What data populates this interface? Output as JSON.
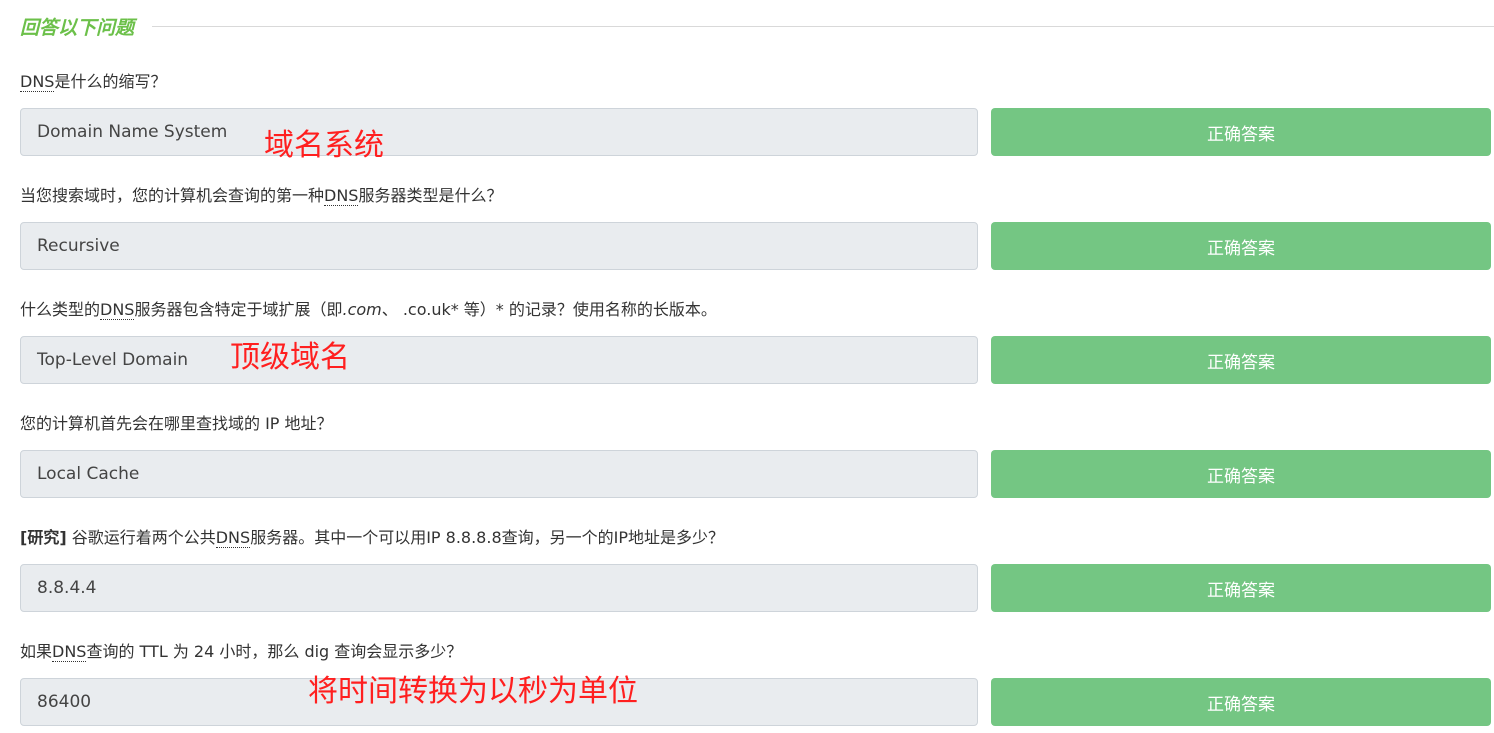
{
  "section": {
    "title": "回答以下问题"
  },
  "questions": [
    {
      "parts": [
        "",
        "DNS",
        "是什么的缩写？"
      ],
      "answer": "Domain Name System",
      "button": "正确答案",
      "note": "域名系统"
    },
    {
      "parts": [
        "当您搜索域时，您的计算机会查询的第一种",
        "DNS",
        "服务器类型是什么？"
      ],
      "answer": "Recursive",
      "button": "正确答案"
    },
    {
      "parts": [
        "什么类型的",
        "DNS",
        "服务器包含特定于域扩展（即",
        ".com",
        "、 .co.uk* 等）* 的记录？使用名称的长版本。"
      ],
      "answer": "Top-Level Domain",
      "button": "正确答案",
      "note": "顶级域名"
    },
    {
      "parts": [
        "您的计算机首先会在哪里查找域的 IP 地址？"
      ],
      "answer": "Local Cache",
      "button": "正确答案"
    },
    {
      "parts": [
        "[研究]",
        " 谷歌运行着两个公共",
        "DNS",
        "服务器。其中一个可以用IP 8.8.8.8查询，另一个的IP地址是多少？"
      ],
      "answer": "8.8.4.4",
      "button": "正确答案"
    },
    {
      "parts": [
        "如果",
        "DNS",
        "查询的 TTL 为 24 小时，那么 dig 查询会显示多少？"
      ],
      "answer": "86400",
      "button": "正确答案",
      "note": "将时间转换为以秒为单位"
    }
  ],
  "colors": {
    "title_green": "#6cc04a",
    "button_green": "#74c683",
    "field_bg": "#e9ecef",
    "note_red": "#ff1f1f"
  }
}
